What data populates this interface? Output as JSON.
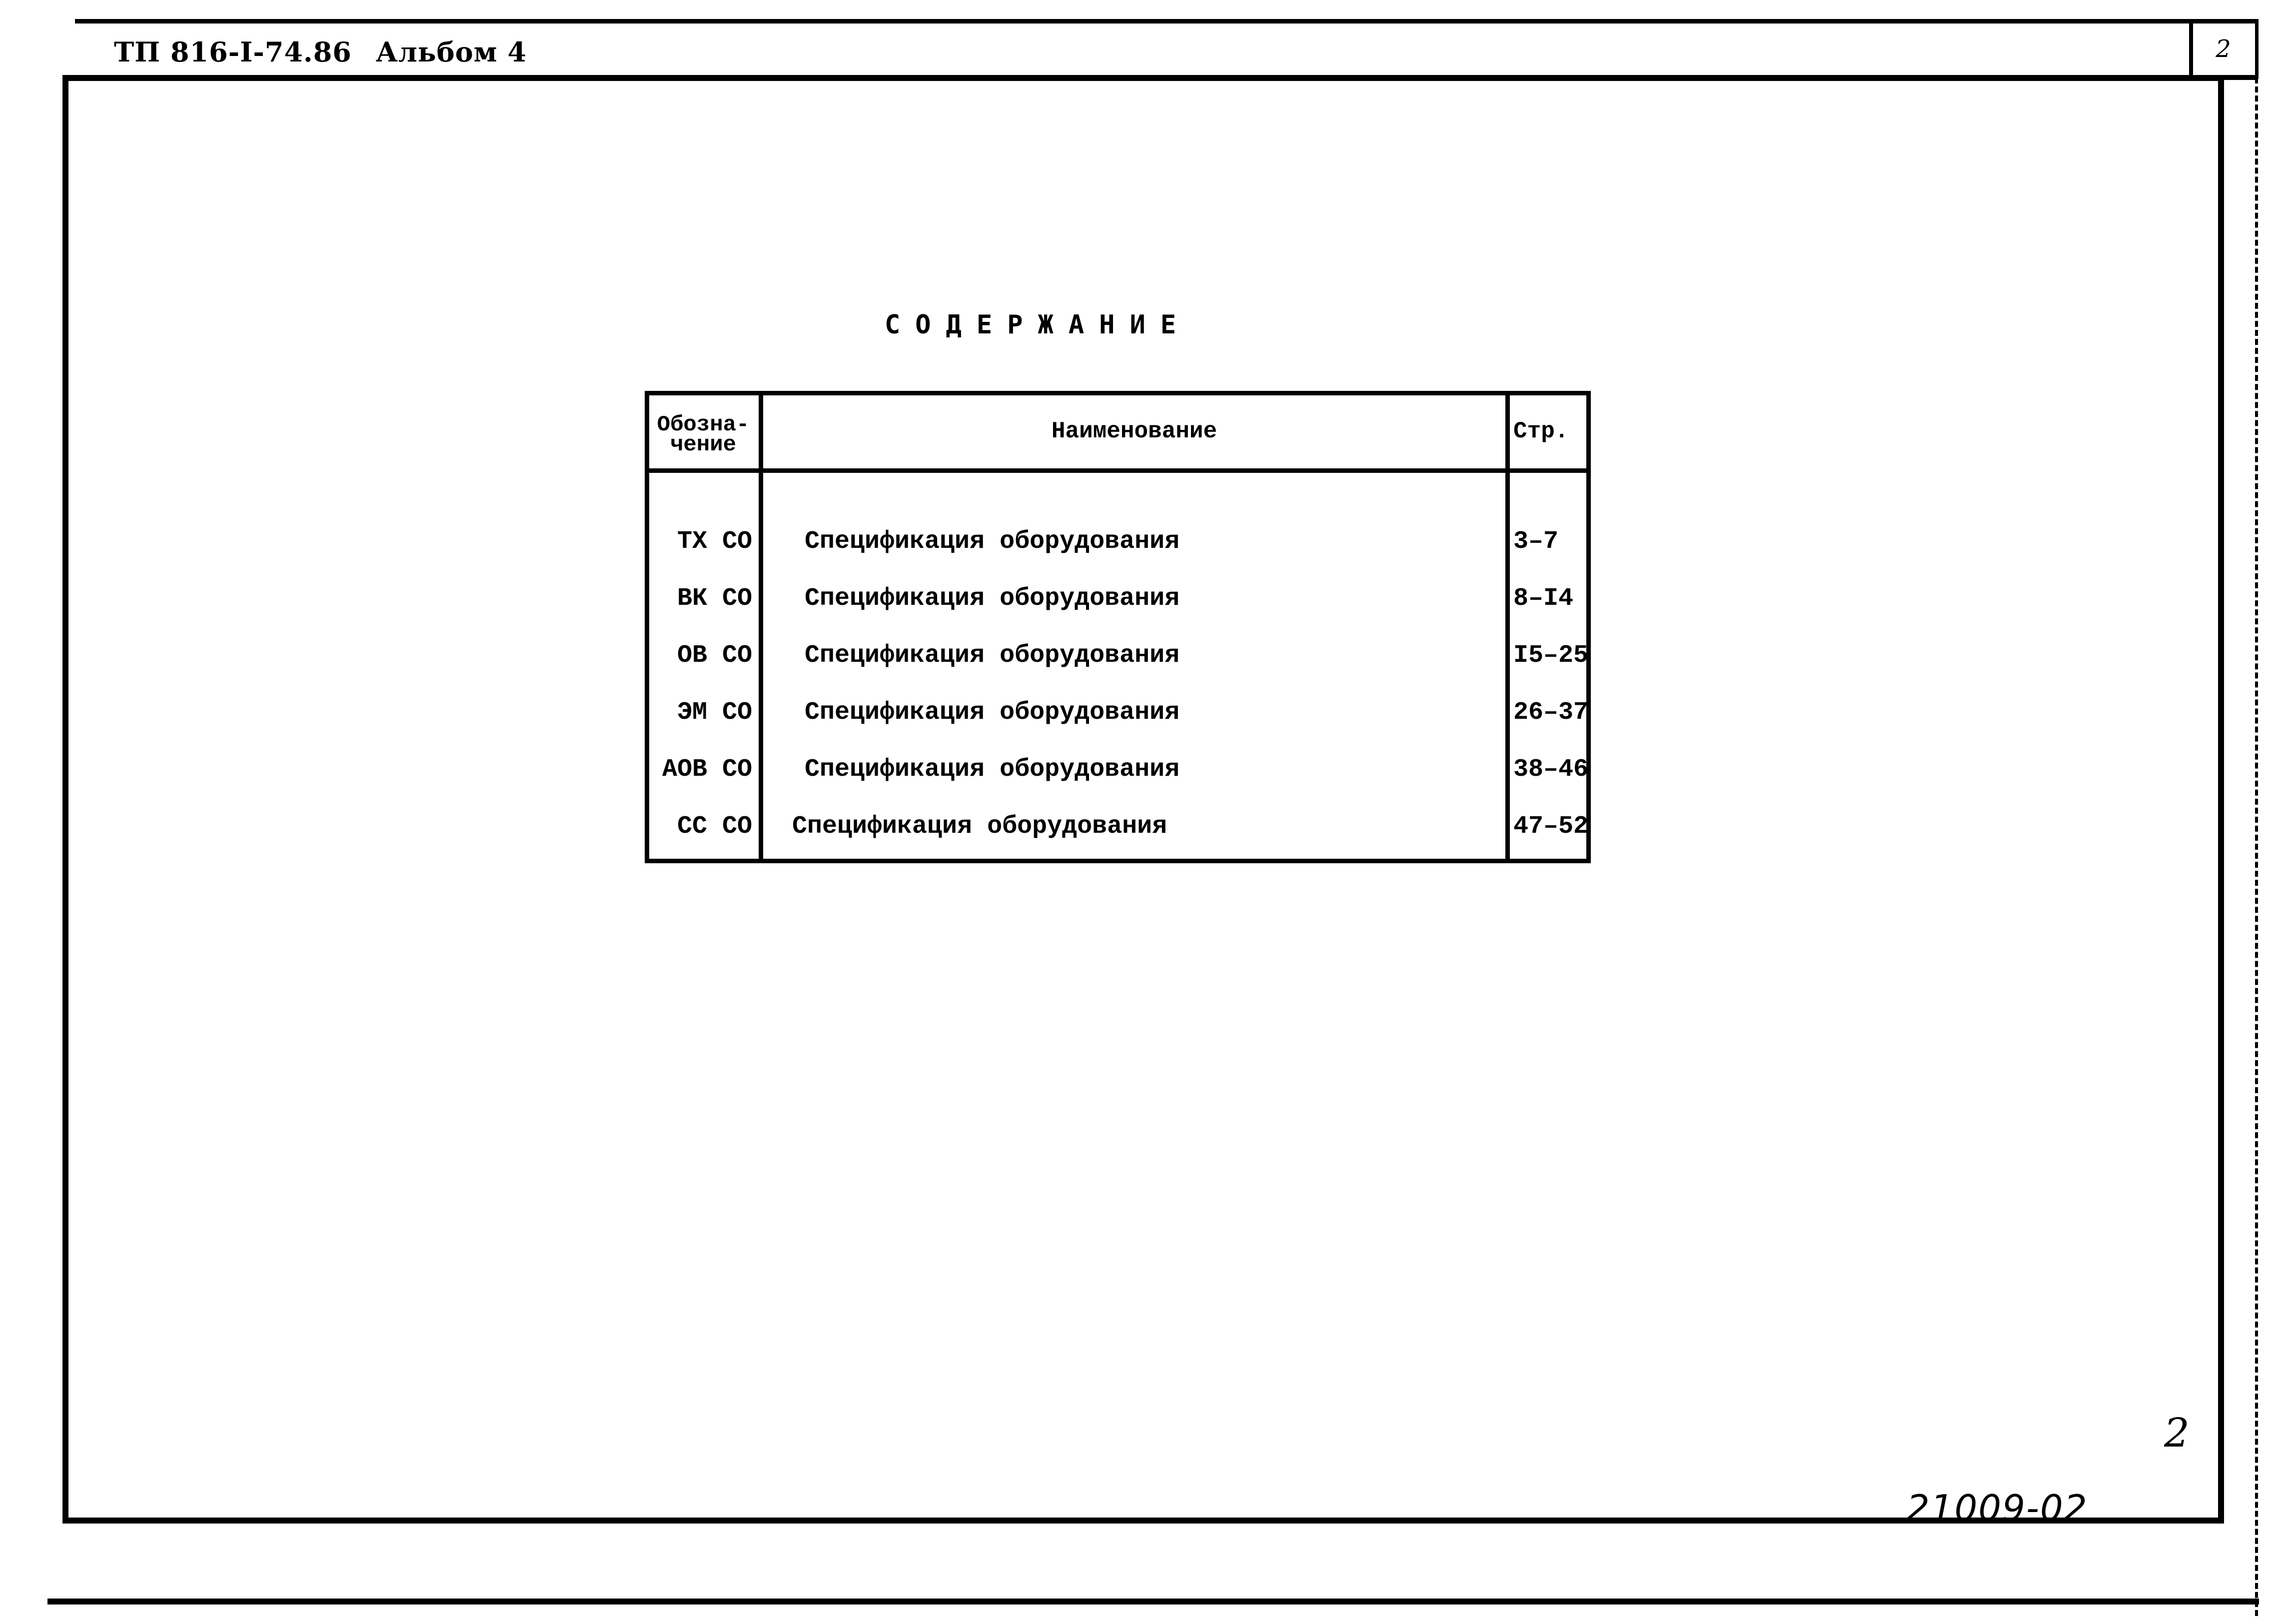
{
  "header": {
    "code": "ТП 816-I-74.86",
    "album": "Альбом 4",
    "sheet_number": "2"
  },
  "title": "СОДЕРЖАНИЕ",
  "table": {
    "columns": {
      "designation": "Обозна-\nчение",
      "designation_line1": "Обозна-",
      "designation_line2": "чение",
      "name": "Наименование",
      "pages": "Стр."
    },
    "rows": [
      {
        "code": "ТХ СО",
        "name": "Спецификация оборудования",
        "pages": "3–7"
      },
      {
        "code": "ВК СО",
        "name": "Спецификация оборудования",
        "pages": "8–I4"
      },
      {
        "code": "ОВ СО",
        "name": "Спецификация оборудования",
        "pages": "I5–25"
      },
      {
        "code": "ЭМ СО",
        "name": "Спецификация оборудования",
        "pages": "26–37"
      },
      {
        "code": "АОВ СО",
        "name": "Спецификация оборудования",
        "pages": "38–46"
      },
      {
        "code": "СС СО",
        "name": "Спецификация оборудования",
        "pages": "47–52"
      }
    ]
  },
  "handwritten": {
    "page_number": "2",
    "document_code": "21009-02"
  }
}
